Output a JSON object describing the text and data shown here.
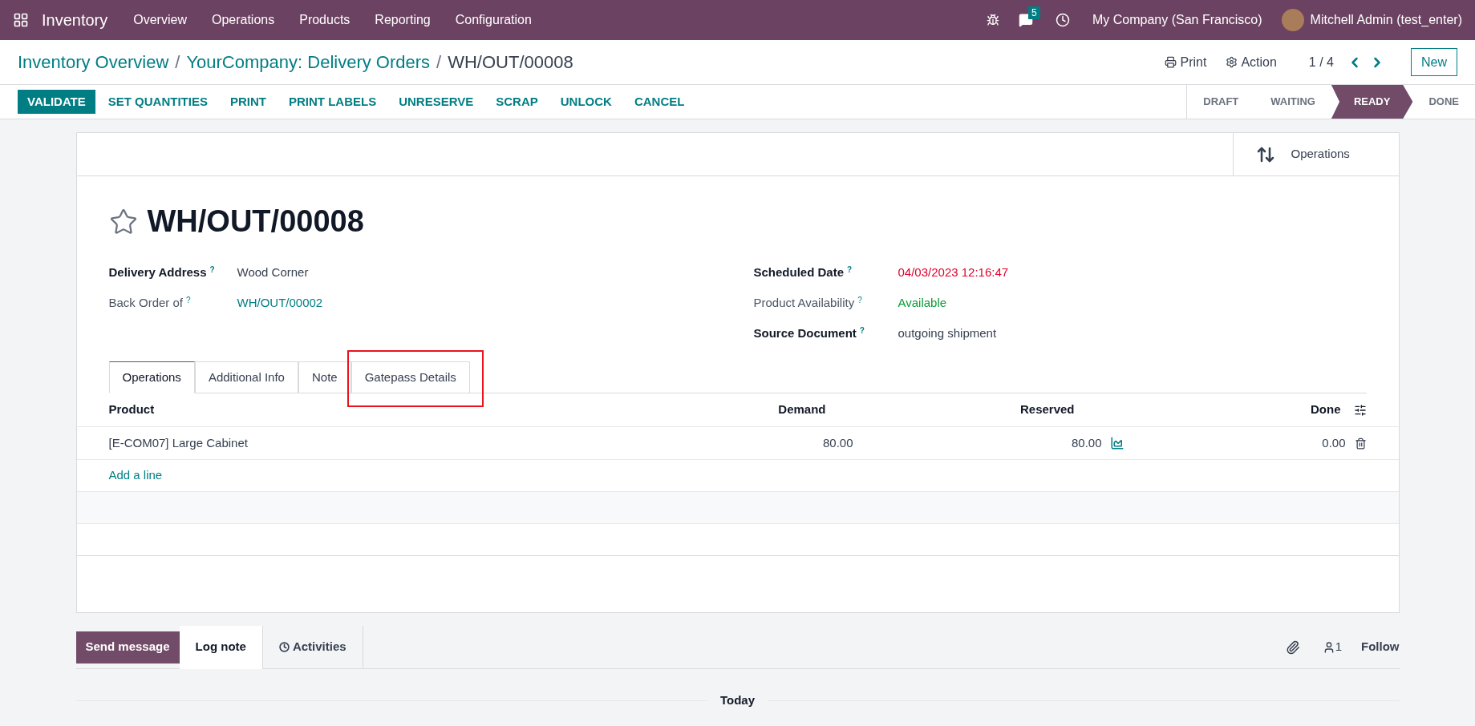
{
  "navbar": {
    "app_name": "Inventory",
    "menu": [
      "Overview",
      "Operations",
      "Products",
      "Reporting",
      "Configuration"
    ],
    "message_count": "5",
    "company": "My Company (San Francisco)",
    "user": "Mitchell Admin (test_enter)"
  },
  "breadcrumb": {
    "separator": "/",
    "items": [
      "Inventory Overview",
      "YourCompany: Delivery Orders"
    ],
    "current": "WH/OUT/00008"
  },
  "record_actions": {
    "print": "Print",
    "action": "Action",
    "pager": "1 / 4",
    "new": "New"
  },
  "buttons": [
    {
      "label": "VALIDATE",
      "primary": true
    },
    {
      "label": "SET QUANTITIES",
      "primary": false
    },
    {
      "label": "PRINT",
      "primary": false
    },
    {
      "label": "PRINT LABELS",
      "primary": false
    },
    {
      "label": "UNRESERVE",
      "primary": false
    },
    {
      "label": "SCRAP",
      "primary": false
    },
    {
      "label": "UNLOCK",
      "primary": false
    },
    {
      "label": "CANCEL",
      "primary": false
    }
  ],
  "status_steps": [
    {
      "label": "DRAFT",
      "selected": false
    },
    {
      "label": "WAITING",
      "selected": false
    },
    {
      "label": "READY",
      "selected": true
    },
    {
      "label": "DONE",
      "selected": false
    }
  ],
  "smart_button": "Operations",
  "record": {
    "title": "WH/OUT/00008",
    "starred": false
  },
  "fields_left": [
    {
      "label": "Delivery Address",
      "help": "?",
      "value": "Wood Corner",
      "bold": true,
      "kind": "text"
    },
    {
      "label": "Back Order of",
      "help": "?",
      "value": "WH/OUT/00002",
      "bold": false,
      "kind": "link"
    }
  ],
  "fields_right": [
    {
      "label": "Scheduled Date",
      "help": "?",
      "value": "04/03/2023 12:16:47",
      "bold": true,
      "kind": "danger"
    },
    {
      "label": "Product Availability",
      "help": "?",
      "value": "Available",
      "bold": false,
      "kind": "success"
    },
    {
      "label": "Source Document",
      "help": "?",
      "value": "outgoing shipment",
      "bold": true,
      "kind": "text"
    }
  ],
  "tabs": [
    {
      "label": "Operations",
      "selected": true,
      "highlighted": false
    },
    {
      "label": "Additional Info",
      "selected": false,
      "highlighted": false
    },
    {
      "label": "Note",
      "selected": false,
      "highlighted": false
    },
    {
      "label": "Gatepass Details",
      "selected": false,
      "highlighted": true
    }
  ],
  "table": {
    "columns": [
      "Product",
      "Demand",
      "Reserved",
      "Done"
    ],
    "rows": [
      {
        "product": "[E-COM07] Large Cabinet",
        "demand": "80.00",
        "reserved": "80.00",
        "done": "0.00"
      }
    ],
    "add_line": "Add a line"
  },
  "chatter": {
    "send_message": "Send message",
    "log_note": "Log note",
    "activities": "Activities",
    "followers": "1",
    "follow": "Follow",
    "date_separator": "Today"
  }
}
